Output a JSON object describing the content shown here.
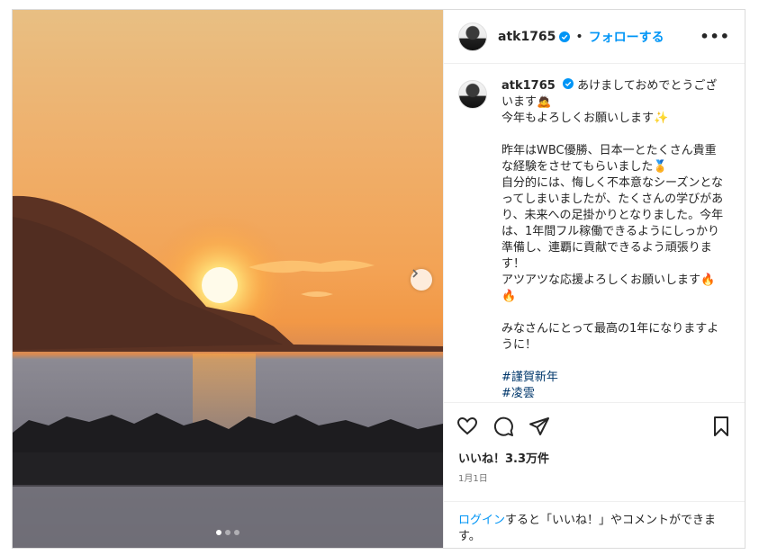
{
  "post": {
    "username": "atk1765",
    "separator": "•",
    "follow_label": "フォローする",
    "more_label": "•••"
  },
  "caption": {
    "username": "atk1765",
    "lines": [
      "あけましておめでとうございます🙇",
      "今年もよろしくお願いします✨",
      "",
      "昨年はWBC優勝、日本一とたくさん貴重な経験をさせてもらいました🏅",
      "自分的には、悔しく不本意なシーズンとなってしまいましたが、たくさんの学びがあり、未来への足掛かりとなりました。今年は、1年間フル稼働できるようにしっかり準備し、連覇に貢献できるよう頑張ります！",
      "アツアツな応援よろしくお願いします🔥🔥",
      "",
      "みなさんにとって最高の1年になりますように！",
      ""
    ],
    "tags": [
      "#謹賀新年",
      "#凌雲"
    ]
  },
  "stats": {
    "likes": "いいね！3.3万件",
    "date": "1月1日"
  },
  "login_prompt": {
    "link": "ログイン",
    "rest": "すると「いいね！」やコメントができます。"
  },
  "carousel": {
    "slide_count": 3,
    "active_index": 0
  },
  "icons": [
    "verified-icon",
    "heart-icon",
    "comment-icon",
    "share-icon",
    "bookmark-icon",
    "chevron-right-icon"
  ],
  "colors": {
    "accent": "#0095f6",
    "verified": "#0095f6",
    "hashtag": "#00376b"
  }
}
